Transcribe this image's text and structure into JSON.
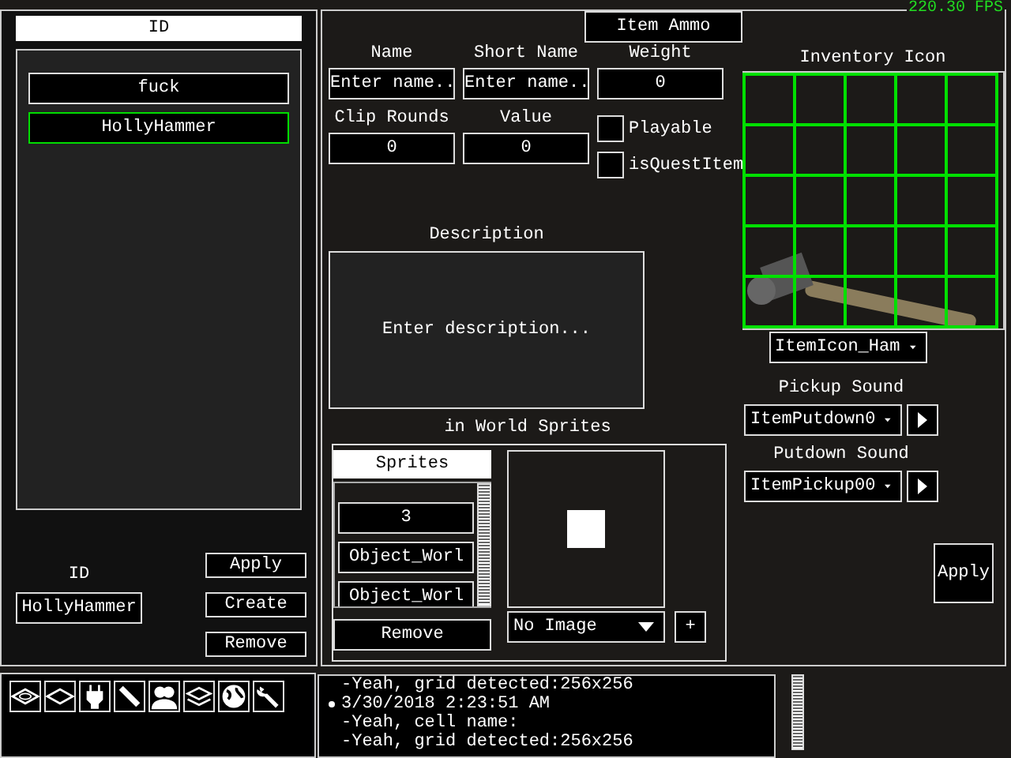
{
  "fps": "220.30 FPS",
  "id_panel": {
    "title": "ID",
    "items": [
      {
        "label": "fuck",
        "selected": false
      },
      {
        "label": "HollyHammer",
        "selected": true
      }
    ],
    "id_label": "ID",
    "id_value": "HollyHammer",
    "buttons": [
      "Apply",
      "Create",
      "Remove"
    ]
  },
  "item": {
    "type_button": "Item Ammo",
    "fields": [
      {
        "label": "Name",
        "placeholder": "Enter name.."
      },
      {
        "label": "Short Name",
        "placeholder": "Enter name.."
      },
      {
        "label": "Weight",
        "value": "0"
      },
      {
        "label": "Clip Rounds",
        "value": "0"
      },
      {
        "label": "Value",
        "value": "0"
      }
    ],
    "checkboxes": [
      {
        "label": "Playable",
        "checked": false
      },
      {
        "label": "isQuestItem",
        "checked": false
      }
    ],
    "description": {
      "label": "Description",
      "placeholder": "Enter description..."
    },
    "inventory_icon": {
      "label": "Inventory Icon",
      "dropdown": "ItemIcon_Ham"
    },
    "sprites": {
      "title": "in World Sprites",
      "tab": "Sprites",
      "items": [
        "3",
        "Object_Worl",
        "Object_Worl"
      ],
      "remove": "Remove",
      "image_dropdown": "No Image",
      "add": "+"
    },
    "sounds": [
      {
        "label": "Pickup Sound",
        "value": "ItemPutdown0"
      },
      {
        "label": "Putdown Sound",
        "value": "ItemPickup00"
      }
    ],
    "apply": "Apply"
  },
  "log": [
    {
      "text": "-Yeah, grid detected:256x256",
      "bullet": false
    },
    {
      "text": "3/30/2018 2:23:51 AM",
      "bullet": true
    },
    {
      "text": "-Yeah, cell name:",
      "bullet": false
    },
    {
      "text": "-Yeah, grid detected:256x256",
      "bullet": false
    }
  ]
}
